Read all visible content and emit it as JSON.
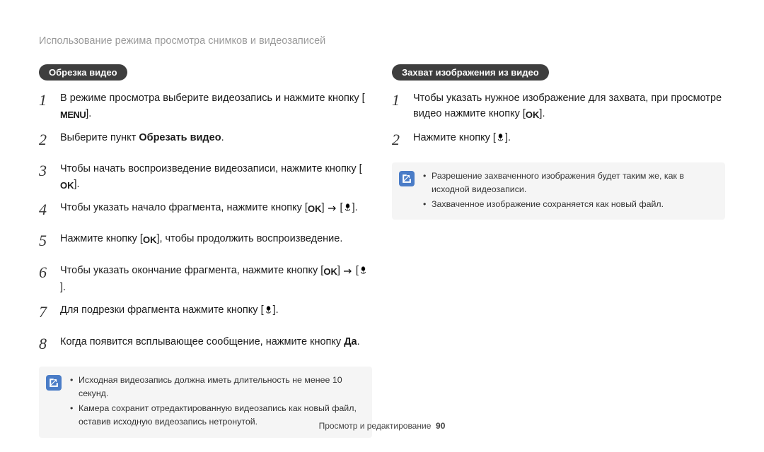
{
  "breadcrumb": "Использование режима просмотра снимков и видеозаписей",
  "left": {
    "heading": "Обрезка видео",
    "steps": [
      {
        "n": "1",
        "parts": [
          "В режиме просмотра выберите видеозапись и нажмите кнопку [",
          {
            "icon": "menu"
          },
          "]."
        ]
      },
      {
        "n": "2",
        "parts": [
          "Выберите пункт ",
          {
            "b": "Обрезать видео"
          },
          "."
        ]
      },
      {
        "n": "3",
        "parts": [
          "Чтобы начать воспроизведение видеозаписи, нажмите кнопку [",
          {
            "icon": "ok"
          },
          "]."
        ]
      },
      {
        "n": "4",
        "parts": [
          "Чтобы указать начало фрагмента, нажмите кнопку [",
          {
            "icon": "ok"
          },
          "] ",
          {
            "icon": "arrow"
          },
          " [",
          {
            "icon": "tulip"
          },
          "]."
        ]
      },
      {
        "n": "5",
        "parts": [
          "Нажмите кнопку [",
          {
            "icon": "ok"
          },
          "], чтобы продолжить воспроизведение."
        ]
      },
      {
        "n": "6",
        "parts": [
          "Чтобы указать окончание фрагмента, нажмите кнопку [",
          {
            "icon": "ok"
          },
          "] ",
          {
            "icon": "arrow"
          },
          " [",
          {
            "icon": "tulip"
          },
          "]."
        ]
      },
      {
        "n": "7",
        "parts": [
          "Для подрезки фрагмента нажмите кнопку [",
          {
            "icon": "tulip"
          },
          "]."
        ]
      },
      {
        "n": "8",
        "parts": [
          "Когда появится всплывающее сообщение, нажмите кнопку ",
          {
            "b": "Да"
          },
          "."
        ]
      }
    ],
    "notes": [
      "Исходная видеозапись должна иметь длительность не менее 10 секунд.",
      "Камера сохранит отредактированную видеозапись как новый файл, оставив исходную видеозапись нетронутой."
    ]
  },
  "right": {
    "heading": "Захват изображения из видео",
    "steps": [
      {
        "n": "1",
        "parts": [
          "Чтобы указать нужное изображение для захвата, при просмотре видео нажмите кнопку [",
          {
            "icon": "ok"
          },
          "]."
        ]
      },
      {
        "n": "2",
        "parts": [
          "Нажмите кнопку [",
          {
            "icon": "tulip"
          },
          "]."
        ]
      }
    ],
    "notes": [
      "Разрешение захваченного изображения будет таким же, как в исходной видеозаписи.",
      "Захваченное изображение сохраняется как новый файл."
    ]
  },
  "footer": {
    "section": "Просмотр и редактирование",
    "page": "90"
  }
}
